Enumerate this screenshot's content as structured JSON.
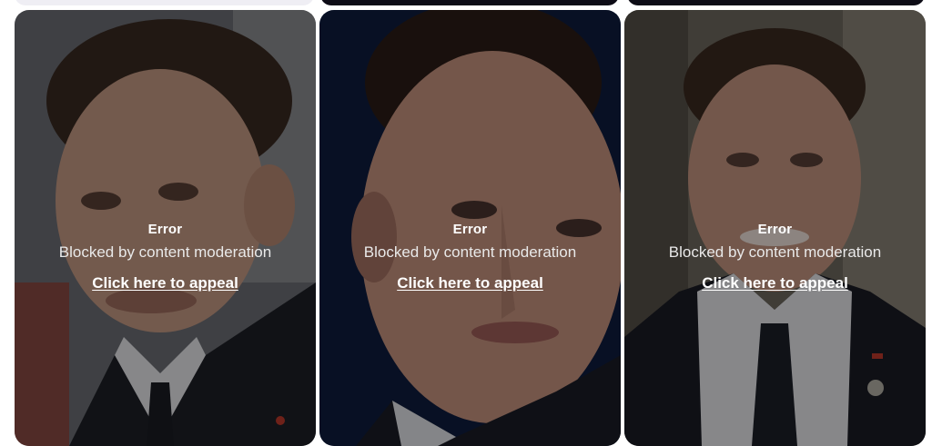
{
  "cards": [
    {
      "error_title": "Error",
      "error_message": "Blocked by content moderation",
      "appeal_label": "Click here to appeal"
    },
    {
      "error_title": "Error",
      "error_message": "Blocked by content moderation",
      "appeal_label": "Click here to appeal"
    },
    {
      "error_title": "Error",
      "error_message": "Blocked by content moderation",
      "appeal_label": "Click here to appeal"
    }
  ]
}
